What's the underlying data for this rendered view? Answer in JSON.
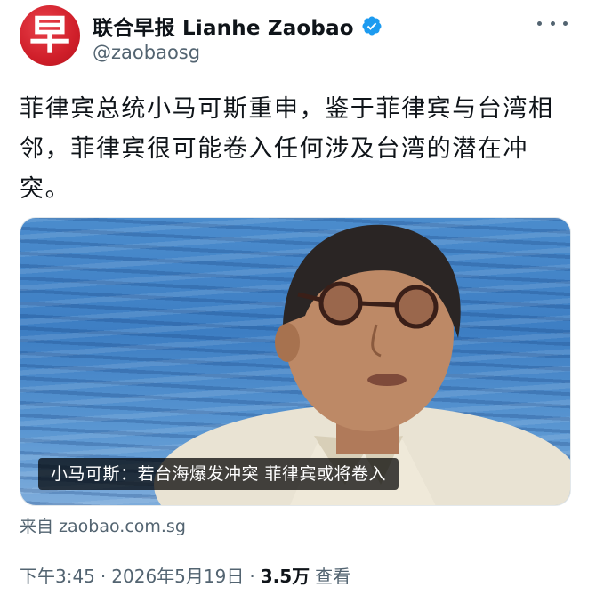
{
  "account": {
    "display_name": "联合早报 Lianhe Zaobao",
    "handle": "@zaobaosg",
    "avatar_glyph": "早",
    "avatar_color": "#d01f2a",
    "verified_color": "#1d9bf0"
  },
  "tweet": {
    "text": "菲律宾总统小马可斯重申，鉴于菲律宾与台湾相邻，菲律宾很可能卷入任何涉及台湾的潜在冲突。"
  },
  "media": {
    "caption": "小马可斯：若台海爆发冲突 菲律宾或将卷入"
  },
  "link": {
    "source": "来自 zaobao.com.sg"
  },
  "meta": {
    "time": "下午3:45",
    "separator": "·",
    "date": "2026年5月19日",
    "views_count": "3.5万",
    "views_label": "查看"
  },
  "icons": {
    "verified": "verified-badge-icon",
    "more": "more-options-icon"
  }
}
